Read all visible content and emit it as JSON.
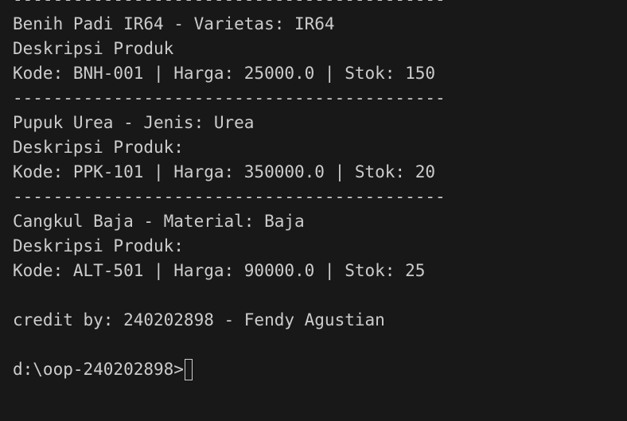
{
  "terminal": {
    "lines": [
      "-------------------------------------------",
      "Benih Padi IR64 - Varietas: IR64",
      "Deskripsi Produk",
      "Kode: BNH-001 | Harga: 25000.0 | Stok: 150",
      "-------------------------------------------",
      "Pupuk Urea - Jenis: Urea",
      "Deskripsi Produk:",
      "Kode: PPK-101 | Harga: 350000.0 | Stok: 20",
      "-------------------------------------------",
      "Cangkul Baja - Material: Baja",
      "Deskripsi Produk:",
      "Kode: ALT-501 | Harga: 90000.0 | Stok: 25",
      "",
      "credit by: 240202898 - Fendy Agustian",
      ""
    ],
    "prompt": "d:\\oop-240202898>"
  }
}
